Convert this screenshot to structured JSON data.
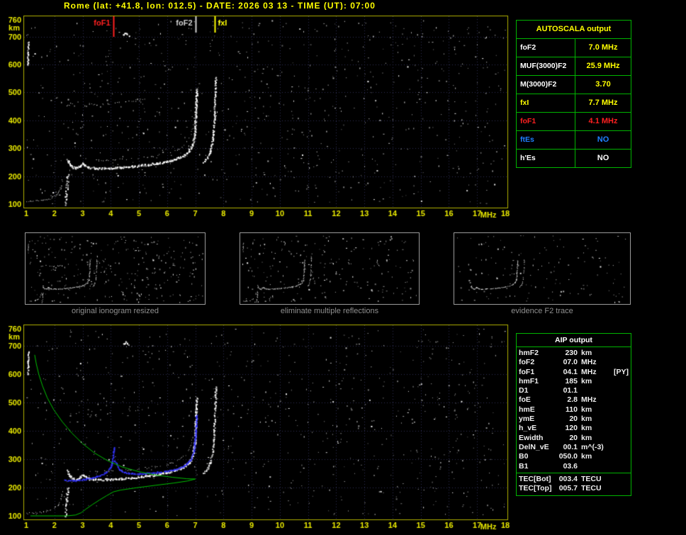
{
  "header": {
    "title": "Rome (lat: +41.8, lon: 012.5) - DATE: 2026 03 13 - TIME (UT): 07:00"
  },
  "colors": {
    "background": "#000000",
    "title": "#ffff00",
    "axis_text": "#e8e800",
    "plot_border": "#b0b000",
    "grid": "#2e2e55",
    "table_border": "#00b400",
    "caption": "#8f8f8f",
    "noise": "#ffffff",
    "profile_green": "#00c000",
    "trace_blue": "#3535ff",
    "marker_red": "#ff2020",
    "marker_gray": "#d0d0d0",
    "marker_yellow": "#ffff00",
    "blue_text": "#2080ff"
  },
  "autoscala_table": {
    "title": "AUTOSCALA output",
    "rows": [
      {
        "label": "foF2",
        "value": "7.0 MHz",
        "label_color": "#ffffff",
        "value_color": "#ffff00"
      },
      {
        "label": "MUF(3000)F2",
        "value": "25.9 MHz",
        "label_color": "#ffffff",
        "value_color": "#ffff00"
      },
      {
        "label": "M(3000)F2",
        "value": "3.70",
        "label_color": "#ffffff",
        "value_color": "#ffff00"
      },
      {
        "label": "fxI",
        "value": "7.7 MHz",
        "label_color": "#ffff00",
        "value_color": "#ffff00"
      },
      {
        "label": "foF1",
        "value": "4.1 MHz",
        "label_color": "#ff2020",
        "value_color": "#ff2020"
      },
      {
        "label": "ftEs",
        "value": "NO",
        "label_color": "#2080ff",
        "value_color": "#2080ff"
      },
      {
        "label": "h'Es",
        "value": "NO",
        "label_color": "#ffffff",
        "value_color": "#ffffff"
      }
    ]
  },
  "thumbnails": [
    {
      "caption": "original ionogram resized"
    },
    {
      "caption": "eliminate multiple reflections"
    },
    {
      "caption": "evidence F2 trace"
    }
  ],
  "aip_table": {
    "title": "AIP output",
    "rows": [
      {
        "name": "hmF2",
        "value": "230",
        "unit": "km",
        "note": ""
      },
      {
        "name": "foF2",
        "value": "07.0",
        "unit": "MHz",
        "note": ""
      },
      {
        "name": "foF1",
        "value": "04.1",
        "unit": "MHz",
        "note": "[PY]"
      },
      {
        "name": "hmF1",
        "value": "185",
        "unit": "km",
        "note": ""
      },
      {
        "name": "D1",
        "value": "01.1",
        "unit": "",
        "note": ""
      },
      {
        "name": "foE",
        "value": "2.8",
        "unit": "MHz",
        "note": ""
      },
      {
        "name": "hmE",
        "value": "110",
        "unit": "km",
        "note": ""
      },
      {
        "name": "ymE",
        "value": "20",
        "unit": "km",
        "note": ""
      },
      {
        "name": "h_vE",
        "value": "120",
        "unit": "km",
        "note": ""
      },
      {
        "name": "Ewidth",
        "value": "20",
        "unit": "km",
        "note": ""
      },
      {
        "name": "DelN_vE",
        "value": "00.1",
        "unit": "m^(-3)",
        "note": ""
      },
      {
        "name": "B0",
        "value": "050.0",
        "unit": "km",
        "note": ""
      },
      {
        "name": "B1",
        "value": "03.6",
        "unit": "",
        "note": ""
      }
    ],
    "tec_rows": [
      {
        "name": "TEC[Bot]",
        "value": "003.4",
        "unit": "TECU",
        "note": ""
      },
      {
        "name": "TEC[Top]",
        "value": "005.7",
        "unit": "TECU",
        "note": ""
      }
    ]
  },
  "chart_data": {
    "trace_points": {
      "e_trace": [
        [
          1.0,
          110
        ],
        [
          1.35,
          112
        ],
        [
          1.7,
          117
        ],
        [
          1.95,
          126
        ],
        [
          2.12,
          140
        ],
        [
          2.22,
          160
        ],
        [
          2.28,
          186
        ]
      ],
      "e_spread": [
        [
          2.38,
          100
        ],
        [
          2.42,
          152
        ],
        [
          2.46,
          206
        ]
      ],
      "f_main": [
        [
          2.45,
          262
        ],
        [
          2.52,
          244
        ],
        [
          2.65,
          233
        ],
        [
          2.8,
          230
        ],
        [
          2.92,
          239
        ],
        [
          3.0,
          248
        ],
        [
          3.08,
          239
        ],
        [
          3.25,
          232
        ],
        [
          3.55,
          229
        ],
        [
          3.95,
          230
        ],
        [
          4.35,
          233
        ],
        [
          4.85,
          237
        ],
        [
          5.35,
          243
        ],
        [
          5.85,
          251
        ],
        [
          6.25,
          261
        ],
        [
          6.55,
          273
        ],
        [
          6.78,
          291
        ],
        [
          6.9,
          316
        ],
        [
          6.97,
          356
        ],
        [
          7.0,
          415
        ],
        [
          7.02,
          470
        ],
        [
          7.04,
          515
        ]
      ],
      "f_second": [
        [
          3.1,
          262
        ],
        [
          3.5,
          258
        ],
        [
          4.0,
          259
        ],
        [
          4.5,
          262
        ],
        [
          5.0,
          266
        ],
        [
          5.5,
          272
        ],
        [
          6.0,
          282
        ],
        [
          6.35,
          295
        ],
        [
          6.6,
          312
        ],
        [
          6.78,
          338
        ],
        [
          6.9,
          372
        ],
        [
          6.97,
          420
        ]
      ],
      "x_branch": [
        [
          7.28,
          252
        ],
        [
          7.42,
          268
        ],
        [
          7.52,
          292
        ],
        [
          7.6,
          328
        ],
        [
          7.65,
          388
        ],
        [
          7.68,
          465
        ],
        [
          7.71,
          555
        ]
      ],
      "second_hop": [
        [
          2.3,
          452
        ],
        [
          2.6,
          460
        ],
        [
          2.85,
          466
        ],
        [
          3.1,
          459
        ],
        [
          3.5,
          456
        ],
        [
          3.9,
          461
        ],
        [
          4.4,
          467
        ],
        [
          4.9,
          472
        ],
        [
          5.2,
          476
        ]
      ],
      "left_streak": [
        [
          1.04,
          600
        ],
        [
          1.05,
          645
        ],
        [
          1.06,
          682
        ]
      ],
      "top_blob": [
        [
          4.42,
          708
        ],
        [
          4.52,
          715
        ],
        [
          4.62,
          706
        ]
      ],
      "blue_rise": [
        [
          2.35,
          227
        ],
        [
          2.7,
          226
        ],
        [
          3.1,
          231
        ],
        [
          3.5,
          240
        ],
        [
          3.8,
          253
        ],
        [
          4.0,
          274
        ],
        [
          4.07,
          308
        ],
        [
          4.1,
          342
        ]
      ],
      "blue_f2": [
        [
          4.13,
          296
        ],
        [
          4.3,
          263
        ],
        [
          4.6,
          252
        ],
        [
          5.0,
          250
        ],
        [
          5.45,
          253
        ],
        [
          5.9,
          258
        ],
        [
          6.3,
          266
        ],
        [
          6.6,
          278
        ],
        [
          6.82,
          297
        ],
        [
          6.94,
          332
        ],
        [
          7.0,
          398
        ],
        [
          7.03,
          458
        ]
      ],
      "profile": [
        [
          1.3,
          668
        ],
        [
          1.36,
          635
        ],
        [
          1.45,
          598
        ],
        [
          1.58,
          558
        ],
        [
          1.75,
          516
        ],
        [
          1.98,
          474
        ],
        [
          2.28,
          432
        ],
        [
          2.62,
          392
        ],
        [
          3.0,
          355
        ],
        [
          3.42,
          322
        ],
        [
          3.9,
          294
        ],
        [
          4.42,
          272
        ],
        [
          5.0,
          256
        ],
        [
          5.6,
          244
        ],
        [
          6.2,
          236
        ],
        [
          6.7,
          231
        ],
        [
          7.0,
          230
        ],
        [
          6.72,
          223
        ],
        [
          6.25,
          216
        ],
        [
          5.6,
          208
        ],
        [
          4.9,
          199
        ],
        [
          4.35,
          191
        ],
        [
          4.1,
          185
        ],
        [
          3.85,
          171
        ],
        [
          3.6,
          156
        ],
        [
          3.35,
          140
        ],
        [
          3.12,
          124
        ],
        [
          2.95,
          111
        ],
        [
          2.75,
          103
        ],
        [
          2.45,
          100
        ],
        [
          2.0,
          100
        ],
        [
          1.5,
          100
        ],
        [
          1.15,
          100
        ]
      ]
    },
    "charts": [
      {
        "id": "top-ionogram",
        "type": "scatter",
        "title": "scaled ionogram with AUTOSCALA characteristic markers",
        "xlabel": "MHz",
        "ylabel": "km",
        "xlim": [
          1,
          18
        ],
        "ylim": [
          100,
          760
        ],
        "xticks": [
          1,
          2,
          3,
          4,
          5,
          6,
          7,
          8,
          9,
          10,
          11,
          12,
          13,
          14,
          15,
          16,
          17,
          18
        ],
        "yticks": [
          100,
          200,
          300,
          400,
          500,
          600,
          700,
          760
        ],
        "grid": true,
        "markers": [
          {
            "label": "foF1",
            "freq": 4.1,
            "color": "#ff2020",
            "len": 30,
            "side": "left"
          },
          {
            "label": "foF2",
            "freq": 7.0,
            "color": "#d0d0d0",
            "len": 24,
            "side": "left"
          },
          {
            "label": "fxI",
            "freq": 7.7,
            "color": "#ffff00",
            "len": 24,
            "side": "right"
          }
        ],
        "noise": {
          "count": 780,
          "seed": 11
        },
        "traces": [
          {
            "ref": "e_trace",
            "color": "#ffffff",
            "size": 1,
            "jitter": 2.0,
            "density": 0.75,
            "step": 1.6
          },
          {
            "ref": "e_spread",
            "color": "#ffffff",
            "size": 2,
            "jitter": 3.0,
            "density": 0.85,
            "step": 1.4
          },
          {
            "ref": "f_main",
            "color": "#ffffff",
            "size": 2,
            "jitter": 2.6,
            "density": 0.95,
            "step": 1.0
          },
          {
            "ref": "f_second",
            "color": "#ffffff",
            "size": 1,
            "jitter": 2.2,
            "density": 0.4,
            "step": 1.8
          },
          {
            "ref": "x_branch",
            "color": "#ffffff",
            "size": 2,
            "jitter": 2.0,
            "density": 0.85,
            "step": 1.2
          },
          {
            "ref": "second_hop",
            "color": "#ffffff",
            "size": 1,
            "jitter": 3.0,
            "density": 0.45,
            "step": 2.0
          },
          {
            "ref": "left_streak",
            "color": "#ffffff",
            "size": 2,
            "jitter": 1.5,
            "density": 0.9,
            "step": 1.2
          },
          {
            "ref": "top_blob",
            "color": "#ffffff",
            "size": 2,
            "jitter": 2.0,
            "density": 0.8,
            "step": 1.4
          }
        ]
      },
      {
        "id": "bottom-ionogram",
        "type": "scatter",
        "title": "ionogram with restored trace and electron density profile",
        "xlabel": "MHz",
        "ylabel": "km",
        "xlim": [
          1,
          18
        ],
        "ylim": [
          100,
          760
        ],
        "xticks": [
          1,
          2,
          3,
          4,
          5,
          6,
          7,
          8,
          9,
          10,
          11,
          12,
          13,
          14,
          15,
          16,
          17,
          18
        ],
        "yticks": [
          100,
          200,
          300,
          400,
          500,
          600,
          700,
          760
        ],
        "grid": true,
        "noise": {
          "count": 700,
          "seed": 23
        },
        "traces": [
          {
            "ref": "e_trace",
            "color": "#ffffff",
            "size": 1,
            "jitter": 2.0,
            "density": 0.7,
            "step": 1.6
          },
          {
            "ref": "e_spread",
            "color": "#ffffff",
            "size": 2,
            "jitter": 3.0,
            "density": 0.8,
            "step": 1.4
          },
          {
            "ref": "f_main",
            "color": "#ffffff",
            "size": 2,
            "jitter": 2.6,
            "density": 0.95,
            "step": 1.0
          },
          {
            "ref": "f_second",
            "color": "#ffffff",
            "size": 1,
            "jitter": 2.2,
            "density": 0.35,
            "step": 1.8
          },
          {
            "ref": "x_branch",
            "color": "#ffffff",
            "size": 2,
            "jitter": 2.0,
            "density": 0.8,
            "step": 1.2
          },
          {
            "ref": "second_hop",
            "color": "#ffffff",
            "size": 1,
            "jitter": 3.0,
            "density": 0.3,
            "step": 2.4
          },
          {
            "ref": "left_streak",
            "color": "#ffffff",
            "size": 2,
            "jitter": 1.5,
            "density": 0.9,
            "step": 1.2
          },
          {
            "ref": "top_blob",
            "color": "#ffffff",
            "size": 2,
            "jitter": 2.0,
            "density": 0.7,
            "step": 1.4
          }
        ],
        "overlays": [
          {
            "ref": "blue_rise",
            "type": "dots",
            "color": "#3535ff",
            "size": 2,
            "jitter": 1.6,
            "density": 0.9,
            "step": 1.1
          },
          {
            "ref": "blue_f2",
            "type": "dots",
            "color": "#3535ff",
            "size": 2,
            "jitter": 1.6,
            "density": 0.9,
            "step": 1.1
          },
          {
            "ref": "profile",
            "type": "line",
            "color": "#00c000",
            "width": 1
          }
        ]
      },
      {
        "id": "thumb-original",
        "type": "scatter",
        "title": "original ionogram resized",
        "xlim": [
          1,
          18
        ],
        "ylim": [
          100,
          760
        ],
        "noise": {
          "count": 300,
          "seed": 5
        },
        "traces": [
          {
            "ref": "e_trace",
            "color": "#ffffff",
            "size": 1,
            "jitter": 1.0,
            "density": 0.55,
            "step": 1.5
          },
          {
            "ref": "e_spread",
            "color": "#ffffff",
            "size": 1,
            "jitter": 1.2,
            "density": 0.7,
            "step": 1.3
          },
          {
            "ref": "f_main",
            "color": "#ffffff",
            "size": 1,
            "jitter": 1.2,
            "density": 0.9,
            "step": 1.0
          },
          {
            "ref": "x_branch",
            "color": "#ffffff",
            "size": 1,
            "jitter": 1.0,
            "density": 0.7,
            "step": 1.2
          },
          {
            "ref": "second_hop",
            "color": "#ffffff",
            "size": 1,
            "jitter": 1.4,
            "density": 0.35,
            "step": 2.0
          },
          {
            "ref": "left_streak",
            "color": "#ffffff",
            "size": 1,
            "jitter": 0.8,
            "density": 0.8,
            "step": 1.2
          }
        ]
      },
      {
        "id": "thumb-clean",
        "type": "scatter",
        "title": "eliminate multiple reflections",
        "xlim": [
          1,
          18
        ],
        "ylim": [
          100,
          760
        ],
        "noise": {
          "count": 230,
          "seed": 6
        },
        "traces": [
          {
            "ref": "e_trace",
            "color": "#ffffff",
            "size": 1,
            "jitter": 1.0,
            "density": 0.5,
            "step": 1.5
          },
          {
            "ref": "e_spread",
            "color": "#ffffff",
            "size": 1,
            "jitter": 1.2,
            "density": 0.6,
            "step": 1.3
          },
          {
            "ref": "f_main",
            "color": "#ffffff",
            "size": 1,
            "jitter": 1.2,
            "density": 0.9,
            "step": 1.0
          },
          {
            "ref": "x_branch",
            "color": "#ffffff",
            "size": 1,
            "jitter": 1.0,
            "density": 0.65,
            "step": 1.2
          },
          {
            "ref": "left_streak",
            "color": "#ffffff",
            "size": 1,
            "jitter": 0.8,
            "density": 0.75,
            "step": 1.2
          }
        ]
      },
      {
        "id": "thumb-f2",
        "type": "scatter",
        "title": "evidence F2 trace",
        "xlim": [
          1,
          18
        ],
        "ylim": [
          100,
          760
        ],
        "noise": {
          "count": 150,
          "seed": 7
        },
        "traces": [
          {
            "ref": "f_main",
            "color": "#ffffff",
            "size": 1,
            "jitter": 1.0,
            "density": 0.85,
            "step": 1.1
          },
          {
            "ref": "x_branch",
            "color": "#ffffff",
            "size": 1,
            "jitter": 0.9,
            "density": 0.55,
            "step": 1.3
          }
        ]
      }
    ]
  }
}
